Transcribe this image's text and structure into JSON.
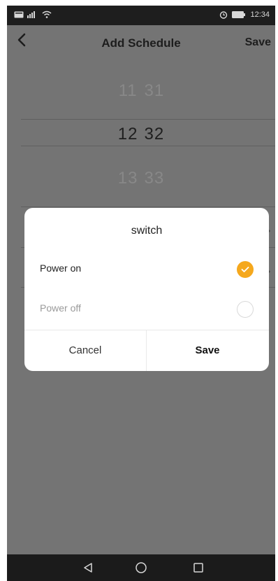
{
  "status_bar": {
    "time": "12:34"
  },
  "header": {
    "back_icon": "chevron-left-icon",
    "title": "Add Schedule",
    "save_label": "Save"
  },
  "time_picker": {
    "previous": {
      "hour": "11",
      "minute": "31"
    },
    "selected": {
      "hour": "12",
      "minute": "32"
    },
    "next": {
      "hour": "13",
      "minute": "33"
    }
  },
  "dialog": {
    "title": "switch",
    "options": [
      {
        "label": "Power on",
        "selected": true
      },
      {
        "label": "Power off",
        "selected": false
      }
    ],
    "cancel_label": "Cancel",
    "save_label": "Save",
    "accent_color": "#f5a81d"
  },
  "nav_bar": {
    "icons": [
      "back-triangle-icon",
      "home-circle-icon",
      "recents-square-icon"
    ]
  }
}
